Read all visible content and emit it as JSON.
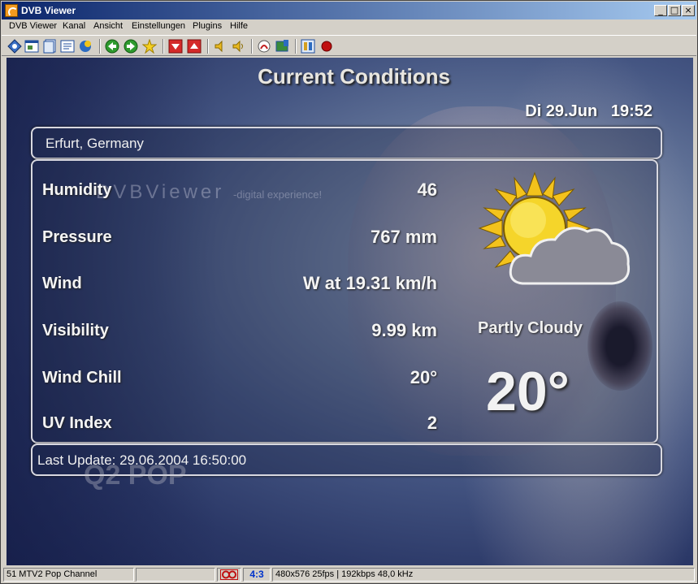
{
  "window": {
    "title": "DVB Viewer"
  },
  "menu": [
    "DVB Viewer",
    "Kanal",
    "Ansicht",
    "Einstellungen",
    "Plugins",
    "Hilfe"
  ],
  "osd": {
    "heading": "Current Conditions",
    "datetime": "Di 29.Jun   19:52",
    "location": "Erfurt, Germany",
    "rows": [
      {
        "label": "Humidity",
        "value": "46"
      },
      {
        "label": "Pressure",
        "value": "767 mm"
      },
      {
        "label": "Wind",
        "value": "W at 19.31 km/h"
      },
      {
        "label": "Visibility",
        "value": "9.99 km"
      },
      {
        "label": "Wind Chill",
        "value": "20°"
      },
      {
        "label": "UV Index",
        "value": "2"
      }
    ],
    "condition": "Partly Cloudy",
    "temperature": "20°",
    "last_update": "Last Update: 29.06.2004 16:50:00",
    "watermark": "DVBViewer",
    "watermark_sub": "-digital experience!",
    "channel_logo": "Q2 POP"
  },
  "status": {
    "channel": "51 MTV2 Pop Channel",
    "aspect": "4:3",
    "info": "480x576 25fps | 192kbps 48,0 kHz"
  }
}
